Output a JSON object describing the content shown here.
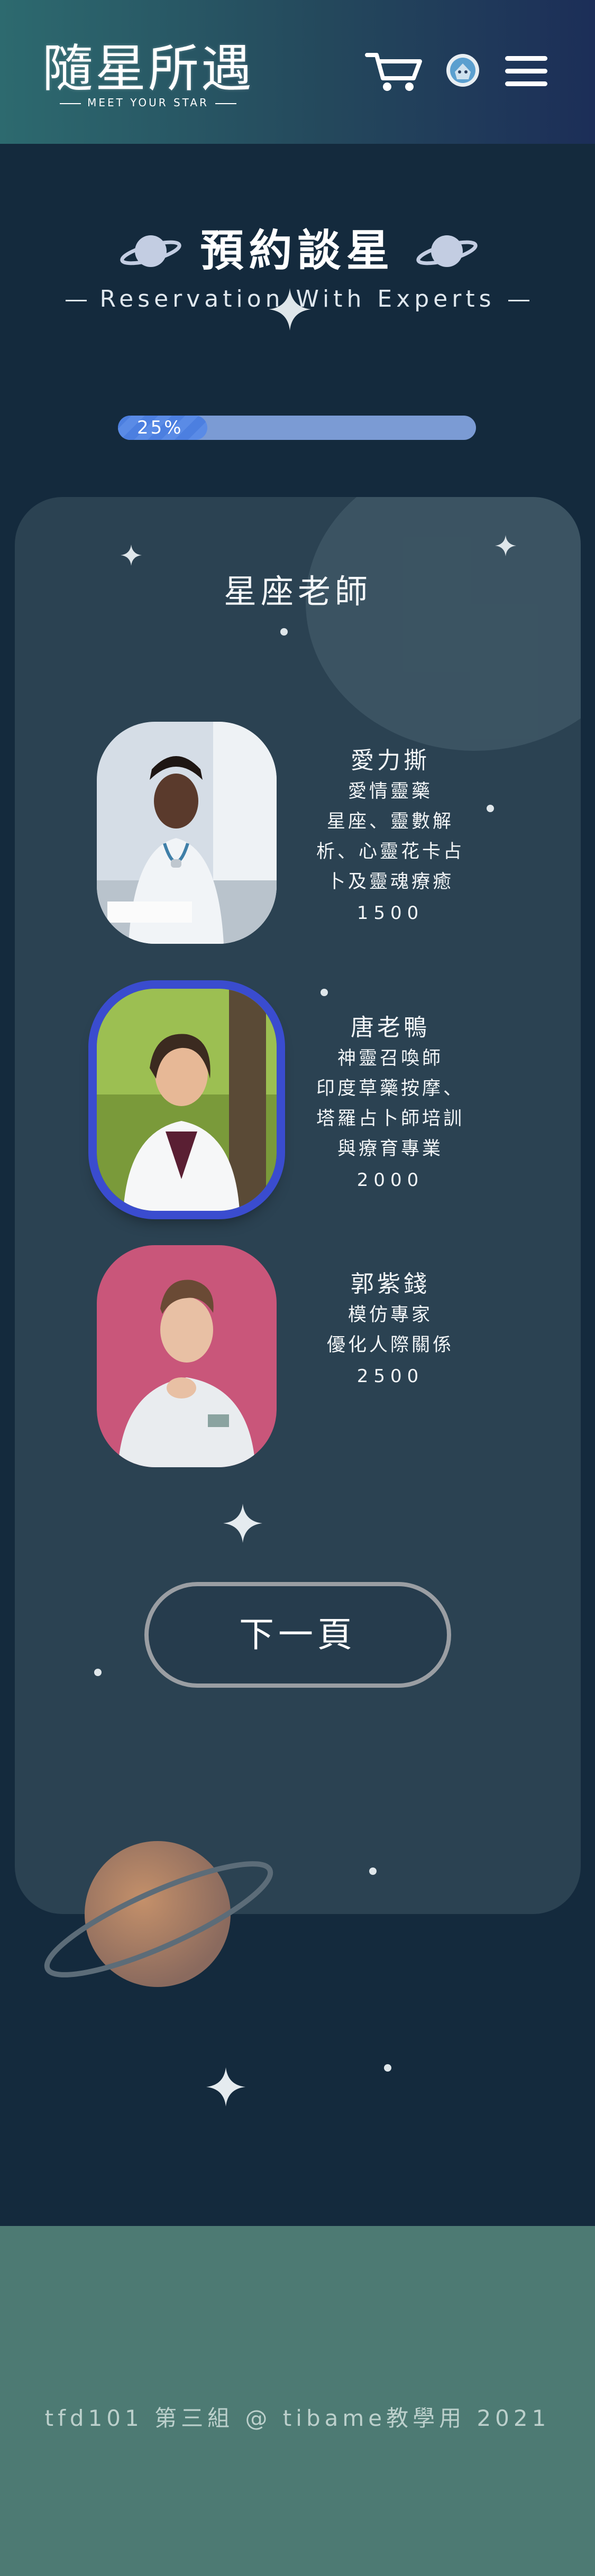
{
  "header": {
    "logo_text": "隨星所遇",
    "logo_tagline": "MEET YOUR STAR",
    "cart_icon": "shopping-cart-icon",
    "avatar_icon": "user-avatar-icon",
    "menu_icon": "hamburger-menu-icon"
  },
  "page": {
    "title": "預約談星",
    "subtitle": "Reservation With Experts",
    "title_icon": "planet-icon"
  },
  "progress": {
    "label": "25%",
    "fraction": 0.25
  },
  "card": {
    "title": "星座老師",
    "teachers": [
      {
        "name": "愛力撕",
        "lines": [
          "愛情靈藥",
          "星座、靈數解",
          "析、心靈花卡占",
          "卜及靈魂療癒"
        ],
        "price": "1500",
        "selected": false
      },
      {
        "name": "唐老鴨",
        "lines": [
          "神靈召喚師",
          "印度草藥按摩、",
          "塔羅占卜師培訓",
          "與療育專業"
        ],
        "price": "2000",
        "selected": true
      },
      {
        "name": "郭紫錢",
        "lines": [
          "模仿專家",
          "優化人際關係"
        ],
        "price": "2500",
        "selected": false
      }
    ],
    "next_button": "下一頁"
  },
  "footer": {
    "text": "tfd101 第三組 @ tibame教學用 2021"
  },
  "colors": {
    "background": "#142a3d",
    "header_start": "#2d6a6f",
    "header_end": "#1c2e58",
    "progress_fill": "#4c7fe0",
    "selected_ring": "#3a4ccf",
    "footer": "#4d7a73"
  }
}
